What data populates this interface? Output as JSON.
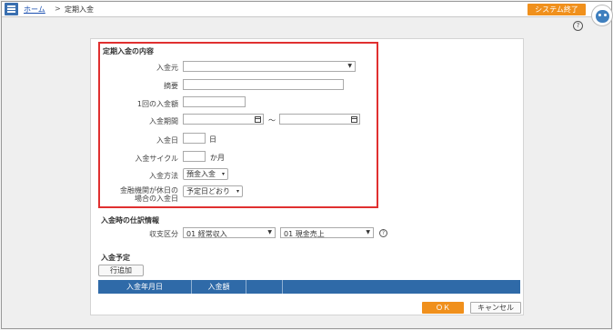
{
  "header": {
    "home_link": "ホーム",
    "separator": ">",
    "current_page": "定期入金",
    "system_exit_button": "システム終了",
    "help_glyph": "?"
  },
  "section_content": {
    "title": "定期入金の内容",
    "source_label": "入金元",
    "source_value": "",
    "memo_label": "摘要",
    "memo_value": "",
    "amount_label": "1回の入金額",
    "amount_value": "",
    "period_label": "入金期間",
    "period_start": "",
    "period_tilde": "～",
    "period_end": "",
    "day_label": "入金日",
    "day_value": "",
    "day_unit": "日",
    "cycle_label": "入金サイクル",
    "cycle_value": "",
    "cycle_unit": "か月",
    "method_label": "入金方法",
    "method_value": "預金入金",
    "holiday_label_line1": "金融機関が休日の",
    "holiday_label_line2": "場合の入金日",
    "holiday_value": "予定日どおり"
  },
  "section_journal": {
    "title": "入金時の仕訳情報",
    "category_label": "収支区分",
    "category_value": "01 経常収入",
    "subcategory_value": "01 現金売上"
  },
  "section_schedule": {
    "title": "入金予定",
    "add_row_button": "行追加",
    "columns": [
      "入金年月日",
      "入金額"
    ]
  },
  "footer": {
    "ok_button": "ＯＫ",
    "cancel_button": "キャンセル"
  },
  "colors": {
    "accent_orange": "#f0901c",
    "header_blue": "#2f6aa8",
    "highlight_red": "#e03030",
    "link_blue": "#1a4fb0"
  }
}
